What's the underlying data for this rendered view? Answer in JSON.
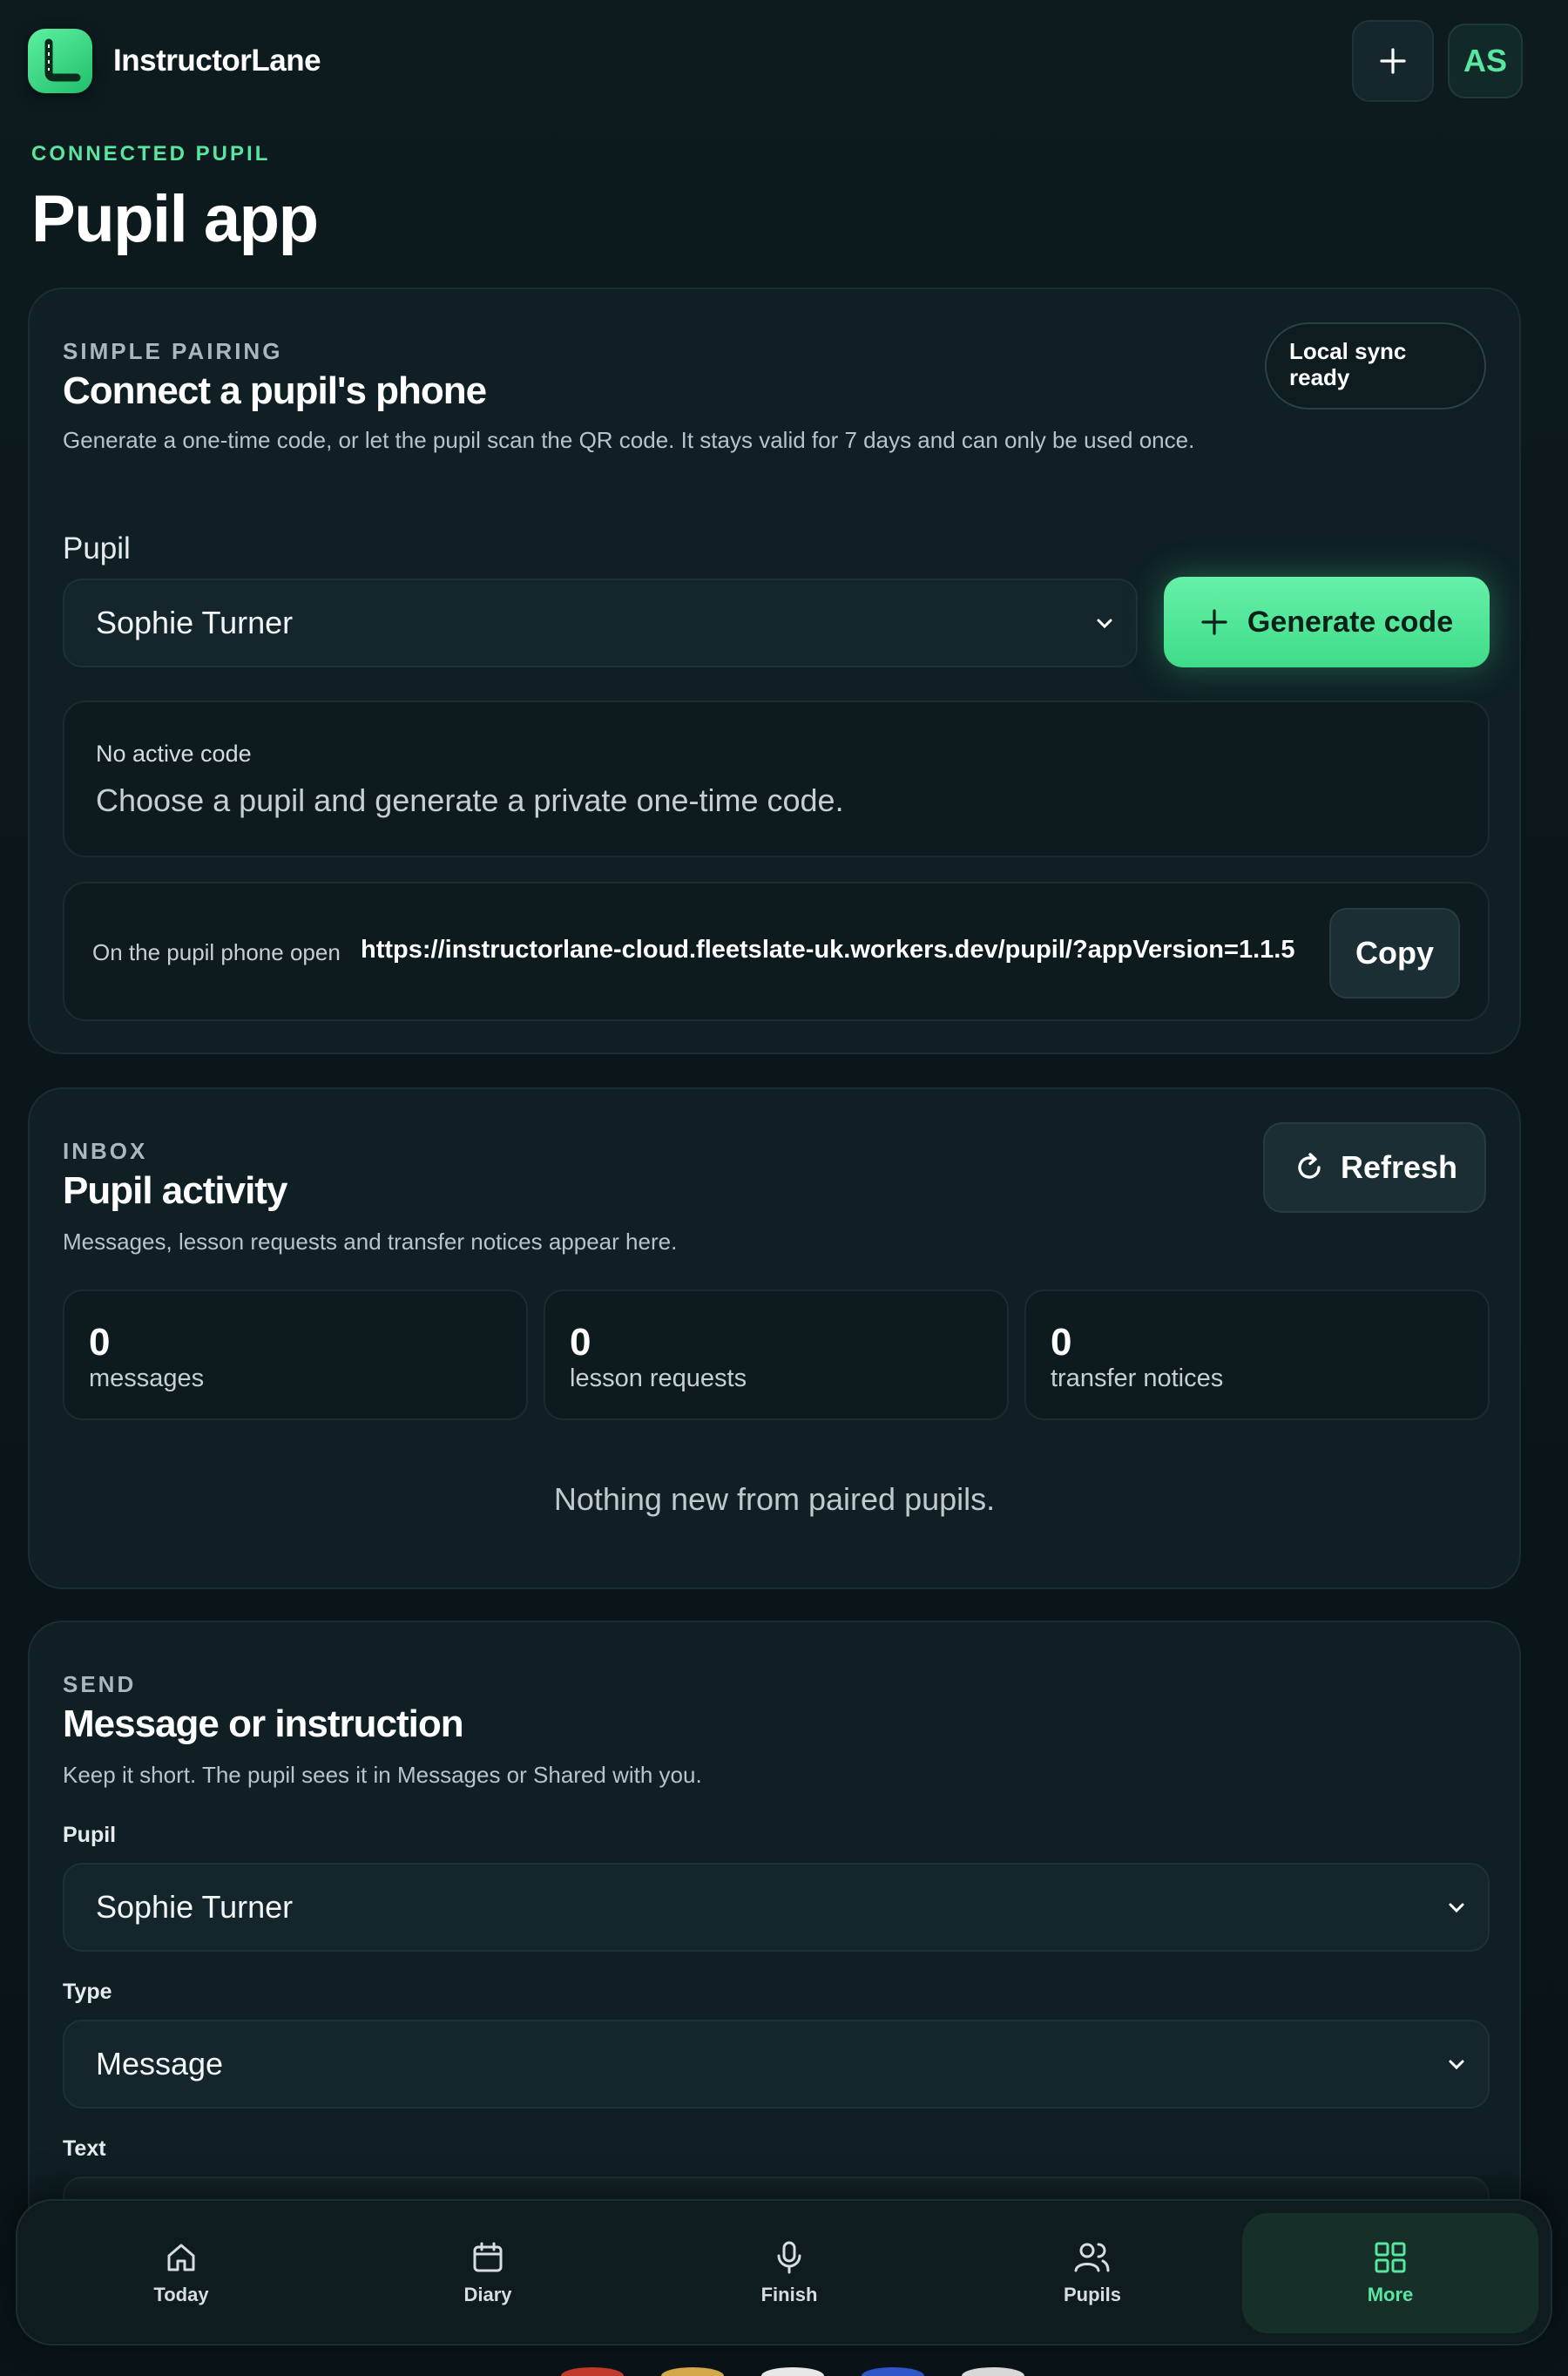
{
  "header": {
    "brand": "InstructorLane",
    "avatar_initials": "AS"
  },
  "page": {
    "eyebrow": "CONNECTED PUPIL",
    "title": "Pupil app"
  },
  "pairing": {
    "eyebrow": "SIMPLE PAIRING",
    "title": "Connect a pupil's phone",
    "description": "Generate a one-time code, or let the pupil scan the QR code. It stays valid for 7 days and can only be used once.",
    "sync_badge": "Local sync ready",
    "pupil_label": "Pupil",
    "pupil_value": "Sophie Turner",
    "generate_label": "Generate code",
    "code_status_title": "No active code",
    "code_status_text": "Choose a pupil and generate a private one-time code.",
    "open_prefix": "On the pupil phone open",
    "open_url": "https://instructorlane-cloud.fleetslate-uk.workers.dev/pupil/?appVersion=1.1.5",
    "copy_label": "Copy"
  },
  "inbox": {
    "eyebrow": "INBOX",
    "title": "Pupil activity",
    "description": "Messages, lesson requests and transfer notices appear here.",
    "refresh_label": "Refresh",
    "stats": [
      {
        "count": "0",
        "label": "messages"
      },
      {
        "count": "0",
        "label": "lesson requests"
      },
      {
        "count": "0",
        "label": "transfer notices"
      }
    ],
    "empty_text": "Nothing new from paired pupils."
  },
  "send": {
    "eyebrow": "SEND",
    "title": "Message or instruction",
    "description": "Keep it short. The pupil sees it in Messages or Shared with you.",
    "pupil_label": "Pupil",
    "pupil_value": "Sophie Turner",
    "type_label": "Type",
    "type_value": "Message",
    "text_label": "Text"
  },
  "nav": {
    "items": [
      {
        "label": "Today",
        "icon": "home-icon"
      },
      {
        "label": "Diary",
        "icon": "calendar-icon"
      },
      {
        "label": "Finish",
        "icon": "microphone-icon"
      },
      {
        "label": "Pupils",
        "icon": "users-icon"
      },
      {
        "label": "More",
        "icon": "grid-icon"
      }
    ],
    "active": "More"
  },
  "colors": {
    "accent": "#58e6a0",
    "background": "#0b161a",
    "card": "#0f1f24"
  }
}
